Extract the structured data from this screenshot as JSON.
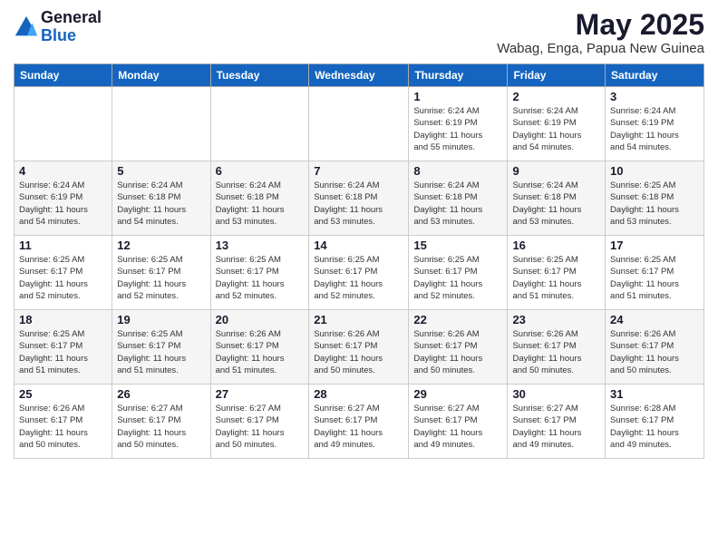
{
  "logo": {
    "line1": "General",
    "line2": "Blue"
  },
  "title": "May 2025",
  "location": "Wabag, Enga, Papua New Guinea",
  "days_of_week": [
    "Sunday",
    "Monday",
    "Tuesday",
    "Wednesday",
    "Thursday",
    "Friday",
    "Saturday"
  ],
  "weeks": [
    [
      {
        "day": "",
        "info": ""
      },
      {
        "day": "",
        "info": ""
      },
      {
        "day": "",
        "info": ""
      },
      {
        "day": "",
        "info": ""
      },
      {
        "day": "1",
        "info": "Sunrise: 6:24 AM\nSunset: 6:19 PM\nDaylight: 11 hours\nand 55 minutes."
      },
      {
        "day": "2",
        "info": "Sunrise: 6:24 AM\nSunset: 6:19 PM\nDaylight: 11 hours\nand 54 minutes."
      },
      {
        "day": "3",
        "info": "Sunrise: 6:24 AM\nSunset: 6:19 PM\nDaylight: 11 hours\nand 54 minutes."
      }
    ],
    [
      {
        "day": "4",
        "info": "Sunrise: 6:24 AM\nSunset: 6:19 PM\nDaylight: 11 hours\nand 54 minutes."
      },
      {
        "day": "5",
        "info": "Sunrise: 6:24 AM\nSunset: 6:18 PM\nDaylight: 11 hours\nand 54 minutes."
      },
      {
        "day": "6",
        "info": "Sunrise: 6:24 AM\nSunset: 6:18 PM\nDaylight: 11 hours\nand 53 minutes."
      },
      {
        "day": "7",
        "info": "Sunrise: 6:24 AM\nSunset: 6:18 PM\nDaylight: 11 hours\nand 53 minutes."
      },
      {
        "day": "8",
        "info": "Sunrise: 6:24 AM\nSunset: 6:18 PM\nDaylight: 11 hours\nand 53 minutes."
      },
      {
        "day": "9",
        "info": "Sunrise: 6:24 AM\nSunset: 6:18 PM\nDaylight: 11 hours\nand 53 minutes."
      },
      {
        "day": "10",
        "info": "Sunrise: 6:25 AM\nSunset: 6:18 PM\nDaylight: 11 hours\nand 53 minutes."
      }
    ],
    [
      {
        "day": "11",
        "info": "Sunrise: 6:25 AM\nSunset: 6:17 PM\nDaylight: 11 hours\nand 52 minutes."
      },
      {
        "day": "12",
        "info": "Sunrise: 6:25 AM\nSunset: 6:17 PM\nDaylight: 11 hours\nand 52 minutes."
      },
      {
        "day": "13",
        "info": "Sunrise: 6:25 AM\nSunset: 6:17 PM\nDaylight: 11 hours\nand 52 minutes."
      },
      {
        "day": "14",
        "info": "Sunrise: 6:25 AM\nSunset: 6:17 PM\nDaylight: 11 hours\nand 52 minutes."
      },
      {
        "day": "15",
        "info": "Sunrise: 6:25 AM\nSunset: 6:17 PM\nDaylight: 11 hours\nand 52 minutes."
      },
      {
        "day": "16",
        "info": "Sunrise: 6:25 AM\nSunset: 6:17 PM\nDaylight: 11 hours\nand 51 minutes."
      },
      {
        "day": "17",
        "info": "Sunrise: 6:25 AM\nSunset: 6:17 PM\nDaylight: 11 hours\nand 51 minutes."
      }
    ],
    [
      {
        "day": "18",
        "info": "Sunrise: 6:25 AM\nSunset: 6:17 PM\nDaylight: 11 hours\nand 51 minutes."
      },
      {
        "day": "19",
        "info": "Sunrise: 6:25 AM\nSunset: 6:17 PM\nDaylight: 11 hours\nand 51 minutes."
      },
      {
        "day": "20",
        "info": "Sunrise: 6:26 AM\nSunset: 6:17 PM\nDaylight: 11 hours\nand 51 minutes."
      },
      {
        "day": "21",
        "info": "Sunrise: 6:26 AM\nSunset: 6:17 PM\nDaylight: 11 hours\nand 50 minutes."
      },
      {
        "day": "22",
        "info": "Sunrise: 6:26 AM\nSunset: 6:17 PM\nDaylight: 11 hours\nand 50 minutes."
      },
      {
        "day": "23",
        "info": "Sunrise: 6:26 AM\nSunset: 6:17 PM\nDaylight: 11 hours\nand 50 minutes."
      },
      {
        "day": "24",
        "info": "Sunrise: 6:26 AM\nSunset: 6:17 PM\nDaylight: 11 hours\nand 50 minutes."
      }
    ],
    [
      {
        "day": "25",
        "info": "Sunrise: 6:26 AM\nSunset: 6:17 PM\nDaylight: 11 hours\nand 50 minutes."
      },
      {
        "day": "26",
        "info": "Sunrise: 6:27 AM\nSunset: 6:17 PM\nDaylight: 11 hours\nand 50 minutes."
      },
      {
        "day": "27",
        "info": "Sunrise: 6:27 AM\nSunset: 6:17 PM\nDaylight: 11 hours\nand 50 minutes."
      },
      {
        "day": "28",
        "info": "Sunrise: 6:27 AM\nSunset: 6:17 PM\nDaylight: 11 hours\nand 49 minutes."
      },
      {
        "day": "29",
        "info": "Sunrise: 6:27 AM\nSunset: 6:17 PM\nDaylight: 11 hours\nand 49 minutes."
      },
      {
        "day": "30",
        "info": "Sunrise: 6:27 AM\nSunset: 6:17 PM\nDaylight: 11 hours\nand 49 minutes."
      },
      {
        "day": "31",
        "info": "Sunrise: 6:28 AM\nSunset: 6:17 PM\nDaylight: 11 hours\nand 49 minutes."
      }
    ]
  ]
}
